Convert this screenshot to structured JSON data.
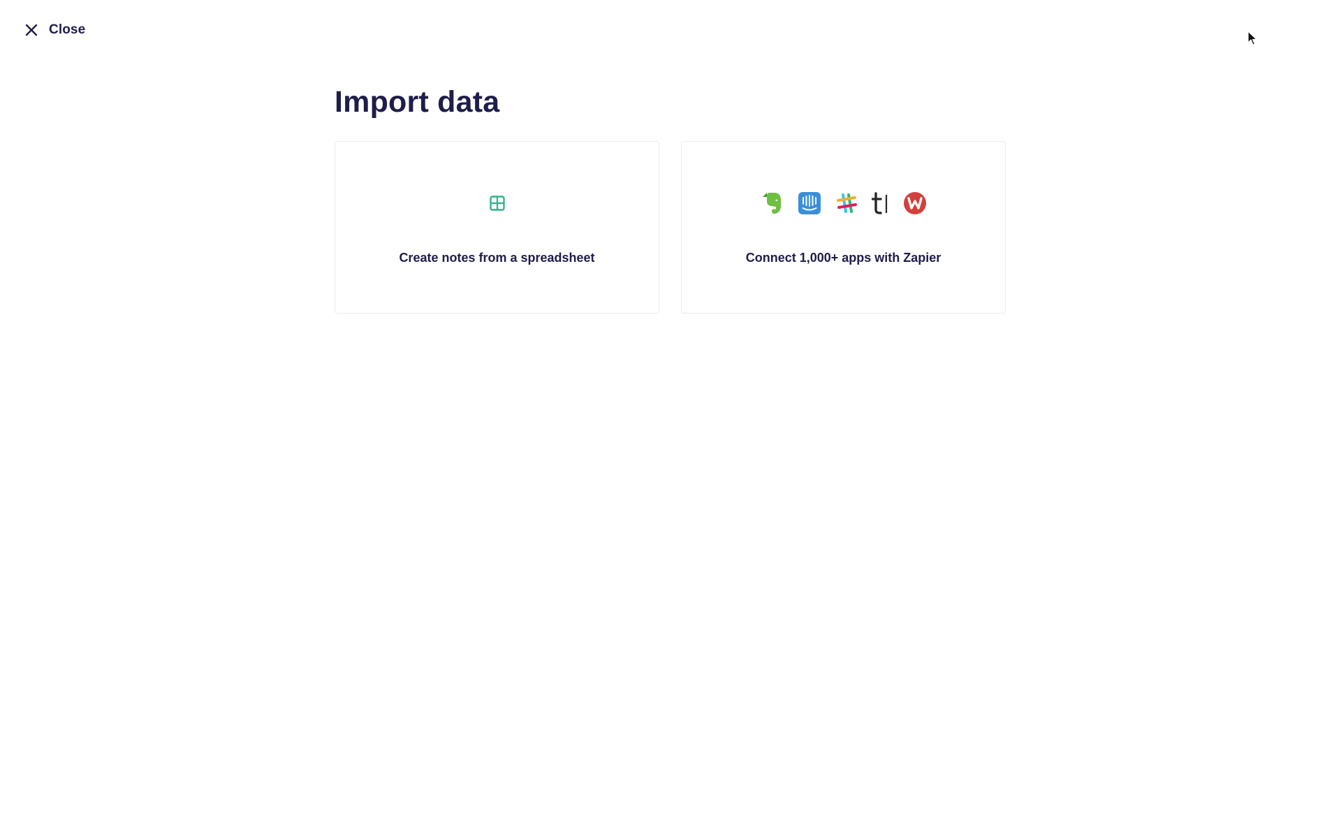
{
  "close": {
    "label": "Close",
    "icon": "close-icon"
  },
  "title": "Import data",
  "cards": [
    {
      "label": "Create notes from a spreadsheet",
      "icon": "spreadsheet-icon",
      "accent": "#2fb38c"
    },
    {
      "label": "Connect 1,000+ apps with Zapier",
      "icons": [
        "evernote-icon",
        "intercom-icon",
        "slack-icon",
        "typeform-icon",
        "wufoo-icon"
      ]
    }
  ],
  "colors": {
    "text": "#1f1d4a",
    "card_border": "#ececf0",
    "spreadsheet_green": "#2fb38c",
    "evernote_green": "#6fbf42",
    "intercom_blue": "#3a8fd9",
    "wufoo_red": "#d2403b"
  }
}
